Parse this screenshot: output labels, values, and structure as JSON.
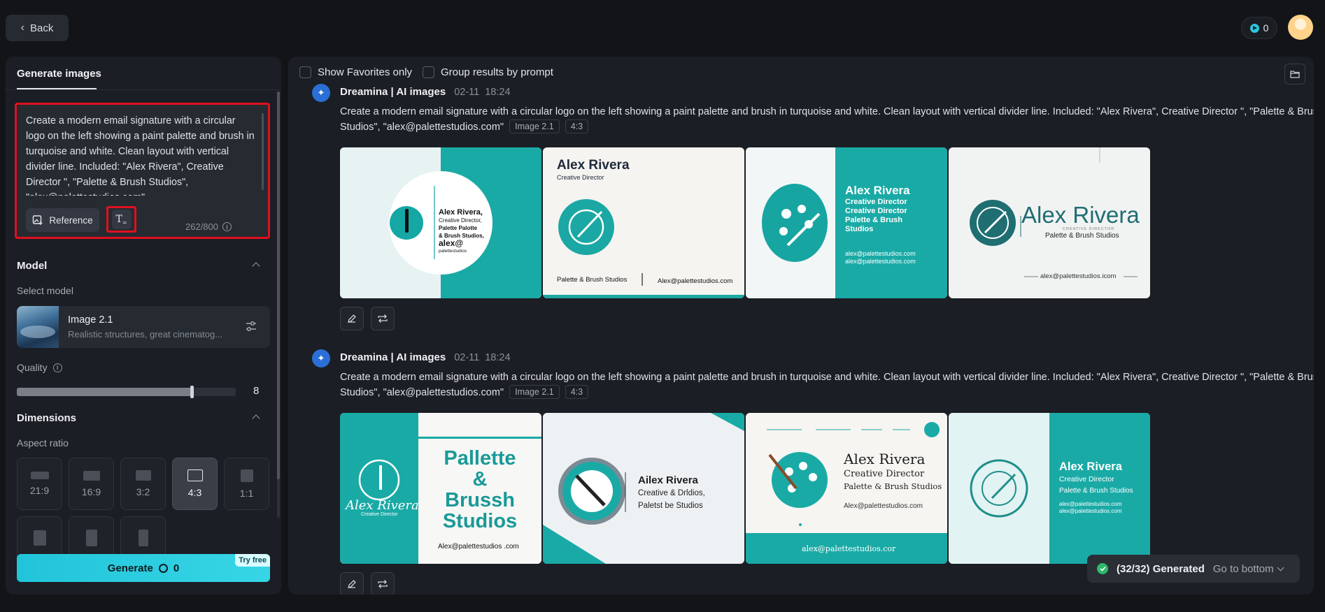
{
  "header": {
    "back_label": "Back",
    "credits": "0"
  },
  "left_panel": {
    "tab": "Generate images",
    "prompt": "Create a modern email signature with a circular logo on the left showing a paint palette and brush in turquoise and white. Clean layout with vertical divider line. Included: \"Alex Rivera\", Creative Director \", \"Palette & Brush Studios\", \"alex@palettestudios.com\"",
    "reference_label": "Reference",
    "char_count": "262/800",
    "model_section": "Model",
    "select_model_label": "Select model",
    "model_name": "Image 2.1",
    "model_desc": "Realistic structures, great cinematog...",
    "quality_label": "Quality",
    "quality_value": "8",
    "quality_fraction": 0.8,
    "dimensions_section": "Dimensions",
    "aspect_ratio_label": "Aspect ratio",
    "aspect_ratios": [
      "21:9",
      "16:9",
      "3:2",
      "4:3",
      "1:1"
    ],
    "selected_ratio": "4:3",
    "generate_label": "Generate",
    "generate_cost": "0",
    "try_free": "Try free"
  },
  "right_panel": {
    "show_favorites": "Show Favorites only",
    "group_results": "Group results by prompt",
    "entries": [
      {
        "source": "Dreamina | AI images",
        "date": "02-11",
        "time": "18:24",
        "prompt": "Create a modern email signature with a circular logo on the left showing a paint palette and brush in turquoise and white. Clean layout with vertical divider line. Included: \"Alex Rivera\", Creative Director \", \"Palette & Brush Studios\", \"alex@palettestudios.com\"",
        "model_tag": "Image 2.1",
        "ratio_tag": "4:3"
      },
      {
        "source": "Dreamina | AI images",
        "date": "02-11",
        "time": "18:24",
        "prompt": "Create a modern email signature with a circular logo on the left showing a paint palette and brush in turquoise and white. Clean layout with vertical divider line. Included: \"Alex Rivera\", Creative Director \", \"Palette & Brush Studios\", \"alex@palettestudios.com\"",
        "model_tag": "Image 2.1",
        "ratio_tag": "4:3"
      }
    ],
    "images_row1": [
      {
        "lines": [
          "Alex Rivera,",
          "Creative Director,",
          "Palette Palotte",
          "& Brush Studios,",
          "alex@",
          "palettestudios"
        ]
      },
      {
        "name": "Alex Rivera",
        "title": "Creative Director",
        "studio": "Palette & Brush Studios",
        "email": "Alex@palettestudios.com"
      },
      {
        "name": "Alex Rivera",
        "title": "Creative Director",
        "title2": "Creative Director",
        "studio": "Palette & Brush Studios",
        "email": "alex@palettestudios.com",
        "email2": "alex@palettestudios.com"
      },
      {
        "name": "Alex Rivera",
        "title": "CREATIVE DIRECTOR",
        "studio": "Palette & Brush Studios",
        "email": "alex@palettestudios.icom"
      }
    ],
    "images_row2": [
      {
        "name": "Alex Rivera",
        "title": "Creative Director",
        "studio1": "Pallette",
        "studio2": "& Brussh",
        "studio3": "Studios",
        "email": "Alex@palettestudios .com"
      },
      {
        "name": "Ailex Rivera",
        "title": "Creative & Drldios,",
        "studio": "Paletst be Studios"
      },
      {
        "name": "Alex Rivera",
        "title": "Creative Director",
        "studio": "Palette & Brush Studios",
        "email": "Alex@palettestudios.com",
        "email2": "alex@palettestudios.cor"
      },
      {
        "name": "Alex Rivera",
        "title": "Creative Director",
        "studio": "Palette & Brush Studios",
        "email": "alex@palettestudios.com",
        "email2": "alex@palettestudios.com"
      }
    ],
    "toast_status": "(32/32) Generated",
    "toast_action": "Go to bottom"
  },
  "colors": {
    "accent": "#22c4da",
    "teal": "#14a7a3",
    "highlight": "#e0101e"
  }
}
